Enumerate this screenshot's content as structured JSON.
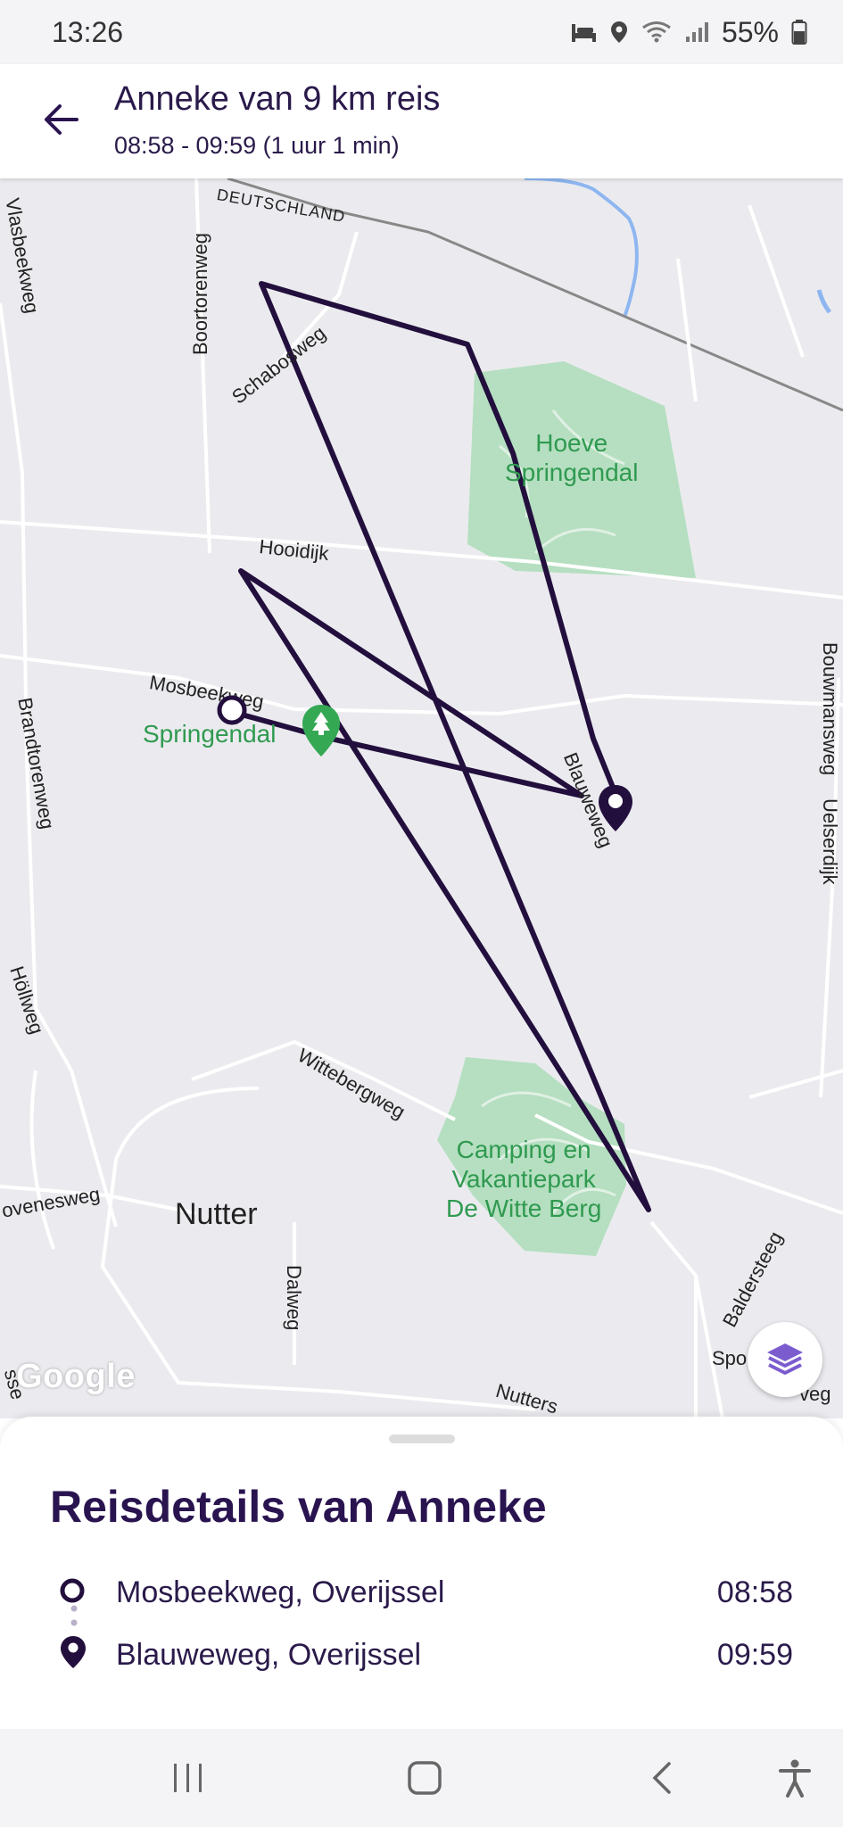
{
  "status_bar": {
    "time": "13:26",
    "battery": "55%"
  },
  "header": {
    "title": "Anneke van 9 km reis",
    "subtitle": "08:58 - 09:59 (1 uur 1 min)"
  },
  "map": {
    "border_label": "DEUTSCHLAND",
    "roads": {
      "boortorenweg": "Boortorenweg",
      "schabosweg": "Schabosweg",
      "hooidijk": "Hooidijk",
      "mosbeekweg": "Mosbeekweg",
      "blauweweg": "Blauweweg",
      "brandtorenweg": "Brandtorenweg",
      "holweg": "Höllweg",
      "bouwmansweg": "Bouwmansweg",
      "uelserdijk": "Uelserdijk",
      "wittebergweg": "Wittebergweg",
      "dalweg": "Dalweg",
      "baldersteeg": "Baldersteeg",
      "ovenesweg": "ovenesweg",
      "nutters": "Nutters",
      "spo": "Spo",
      "veg": "veg",
      "vlasbeekweg": "Vlasbeekweg",
      "sse": "sse"
    },
    "places": {
      "hoeve": "Hoeve\nSpringendal",
      "springendal": "Springendal",
      "camping": "Camping en\nVakantiepark\nDe Witte Berg",
      "town": "Nutter"
    },
    "attribution": "Google",
    "route_color": "#230f3d",
    "park_color": "#b5dfc0"
  },
  "trip": {
    "title": "Reisdetails van Anneke",
    "start": {
      "place": "Mosbeekweg, Overijssel",
      "time": "08:58"
    },
    "end": {
      "place": "Blauweweg, Overijssel",
      "time": "09:59"
    }
  }
}
